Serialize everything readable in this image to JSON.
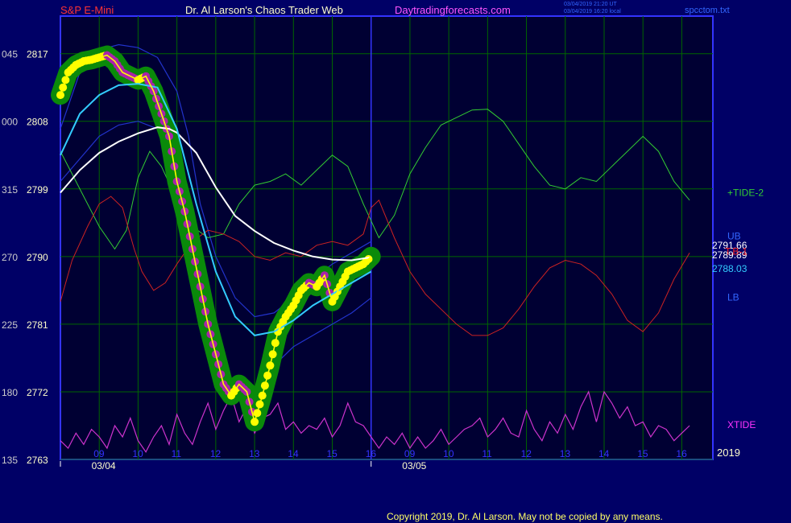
{
  "header": {
    "left": "S&P E-Mini",
    "center": "Dr. Al Larson's Chaos Trader Web",
    "site": "Daytradingforecasts.com",
    "stamp1": "03/04/2019 21:20 UT",
    "stamp2": "03/04/2019 16:20 local",
    "file": "spcctom.txt"
  },
  "footer": {
    "copyright": "Copyright 2019, Dr. Al Larson. May not be copied by any means."
  },
  "colors": {
    "background": "#000066",
    "plot_bg": "#000033",
    "grid": "#006600",
    "frame": "#3333ff",
    "price": "#ffff00",
    "aux_axis": "#cccccc",
    "price_axis": "#ffffcc",
    "tide2": "#33cc33",
    "red_tide": "#cc2222",
    "xtide": "#cc33cc",
    "white_ma": "#ffffff",
    "cyan_ma": "#33ccff",
    "blue_band": "#2233cc",
    "green_halo": "#0a8a0a",
    "yellow_dot": "#ffff00",
    "magenta_dot": "#aa22aa"
  },
  "chart_data": {
    "type": "line",
    "title": "S&P E-Mini",
    "ylim": [
      2763,
      2822
    ],
    "xlim": [
      8.0,
      24.8
    ],
    "y_ticks": [
      {
        "aux": "135",
        "price": "2763"
      },
      {
        "aux": "180",
        "price": "2772"
      },
      {
        "aux": "225",
        "price": "2781"
      },
      {
        "aux": "270",
        "price": "2790"
      },
      {
        "aux": "315",
        "price": "2799"
      },
      {
        "aux": "000",
        "price": "2808"
      },
      {
        "aux": "045",
        "price": "2817"
      }
    ],
    "x_ticks": [
      {
        "label": "09",
        "x": 9
      },
      {
        "label": "10",
        "x": 10
      },
      {
        "label": "11",
        "x": 11
      },
      {
        "label": "12",
        "x": 12
      },
      {
        "label": "13",
        "x": 13
      },
      {
        "label": "14",
        "x": 14
      },
      {
        "label": "15",
        "x": 15
      },
      {
        "label": "16",
        "x": 16
      },
      {
        "label": "09",
        "x": 17
      },
      {
        "label": "10",
        "x": 18
      },
      {
        "label": "11",
        "x": 19
      },
      {
        "label": "12",
        "x": 20
      },
      {
        "label": "13",
        "x": 21
      },
      {
        "label": "14",
        "x": 22
      },
      {
        "label": "15",
        "x": 23
      },
      {
        "label": "16",
        "x": 24
      }
    ],
    "date_labels": [
      {
        "label": "03/04",
        "x": 8.8
      },
      {
        "label": "03/05",
        "x": 16.8
      }
    ],
    "year_label": "2019",
    "day_divider_x": 16.0,
    "series": [
      {
        "name": "price",
        "x": [
          8.0,
          8.2,
          8.4,
          8.6,
          8.8,
          9.0,
          9.2,
          9.4,
          9.6,
          9.8,
          10.0,
          10.2,
          10.4,
          10.6,
          10.8,
          11.0,
          11.2,
          11.4,
          11.6,
          11.8,
          12.0,
          12.2,
          12.4,
          12.6,
          12.8,
          13.0,
          13.2,
          13.4,
          13.6,
          13.8,
          14.0,
          14.2,
          14.4,
          14.6,
          14.8,
          15.0,
          15.2,
          15.4,
          15.6,
          15.8,
          16.0
        ],
        "y": [
          2811.5,
          2814.5,
          2815.5,
          2816.0,
          2816.2,
          2816.5,
          2816.8,
          2816.0,
          2814.5,
          2814.0,
          2813.5,
          2814.0,
          2812.0,
          2809.0,
          2806.0,
          2800.0,
          2796.0,
          2791.0,
          2786.0,
          2781.0,
          2777.0,
          2773.0,
          2771.5,
          2773.0,
          2772.0,
          2768.0,
          2771.5,
          2775.5,
          2780.0,
          2782.0,
          2783.5,
          2785.5,
          2786.5,
          2786.0,
          2787.5,
          2784.0,
          2786.0,
          2788.0,
          2788.5,
          2789.0,
          2790.0
        ]
      },
      {
        "name": "white",
        "x": [
          8.0,
          8.5,
          9.0,
          9.5,
          10.0,
          10.5,
          10.8,
          11.0,
          11.5,
          12.0,
          12.5,
          13.0,
          13.5,
          14.0,
          14.5,
          15.0,
          15.5,
          16.0
        ],
        "y": [
          2798.5,
          2801.5,
          2803.8,
          2805.3,
          2806.4,
          2807.2,
          2807.0,
          2806.5,
          2803.8,
          2799.2,
          2795.4,
          2793.4,
          2791.8,
          2790.8,
          2790.0,
          2789.6,
          2789.5,
          2789.9
        ]
      },
      {
        "name": "cyan",
        "x": [
          8.0,
          8.5,
          9.0,
          9.5,
          10.0,
          10.5,
          11.0,
          11.5,
          12.0,
          12.5,
          13.0,
          13.5,
          14.0,
          14.5,
          15.0,
          15.5,
          16.0
        ],
        "y": [
          2803.5,
          2809.0,
          2811.5,
          2812.8,
          2813.0,
          2812.5,
          2807.0,
          2797.0,
          2788.0,
          2782.0,
          2779.5,
          2780.0,
          2781.5,
          2783.5,
          2785.0,
          2786.5,
          2788.0
        ]
      },
      {
        "name": "+TIDE-2",
        "x": [
          8.0,
          8.3,
          8.6,
          9.0,
          9.4,
          9.7,
          10.0,
          10.3,
          10.6,
          11.0,
          11.4,
          11.8,
          12.2,
          12.6,
          13.0,
          13.4,
          13.8,
          14.2,
          14.6,
          15.0,
          15.4,
          15.8,
          16.2,
          16.6,
          17.0,
          17.4,
          17.8,
          18.2,
          18.6,
          19.0,
          19.4,
          19.8,
          20.2,
          20.6,
          21.0,
          21.4,
          21.8,
          22.2,
          22.6,
          23.0,
          23.4,
          23.8,
          24.2
        ],
        "y": [
          2804.0,
          2801.0,
          2798.0,
          2794.0,
          2791.0,
          2793.5,
          2800.5,
          2804.0,
          2802.0,
          2797.5,
          2794.0,
          2792.5,
          2793.0,
          2797.0,
          2799.5,
          2800.0,
          2801.0,
          2799.5,
          2801.5,
          2803.5,
          2802.0,
          2797.0,
          2792.5,
          2795.5,
          2801.0,
          2804.5,
          2807.5,
          2808.5,
          2809.5,
          2809.6,
          2808.0,
          2805.0,
          2802.0,
          2799.5,
          2799.0,
          2800.5,
          2800.0,
          2802.0,
          2804.0,
          2806.0,
          2804.0,
          2800.0,
          2797.5
        ]
      },
      {
        "name": "red tide",
        "x": [
          8.0,
          8.3,
          8.7,
          9.0,
          9.3,
          9.6,
          9.9,
          10.1,
          10.4,
          10.7,
          11.0,
          11.4,
          11.8,
          12.2,
          12.6,
          13.0,
          13.4,
          13.8,
          14.2,
          14.6,
          15.0,
          15.4,
          15.8,
          16.0,
          16.2,
          16.6,
          17.0,
          17.4,
          17.8,
          18.2,
          18.6,
          19.0,
          19.4,
          19.8,
          20.2,
          20.6,
          21.0,
          21.4,
          21.8,
          22.2,
          22.6,
          23.0,
          23.4,
          23.8,
          24.2
        ],
        "y": [
          2784.0,
          2789.5,
          2794.0,
          2797.0,
          2798.0,
          2796.5,
          2791.0,
          2788.0,
          2785.5,
          2786.5,
          2789.0,
          2792.0,
          2793.5,
          2793.0,
          2792.0,
          2790.0,
          2789.5,
          2790.5,
          2790.0,
          2791.5,
          2792.0,
          2791.5,
          2793.0,
          2796.5,
          2797.5,
          2792.5,
          2788.0,
          2785.0,
          2783.0,
          2781.0,
          2779.5,
          2779.5,
          2780.5,
          2783.0,
          2786.0,
          2788.5,
          2789.5,
          2789.0,
          2787.5,
          2785.0,
          2781.5,
          2780.0,
          2782.5,
          2787.0,
          2790.5
        ]
      },
      {
        "name": "XTIDE",
        "x": [
          8.0,
          8.2,
          8.4,
          8.6,
          8.8,
          9.0,
          9.2,
          9.4,
          9.6,
          9.8,
          10.0,
          10.2,
          10.4,
          10.6,
          10.8,
          11.0,
          11.2,
          11.4,
          11.6,
          11.8,
          12.0,
          12.2,
          12.4,
          12.6,
          12.8,
          13.0,
          13.2,
          13.4,
          13.6,
          13.8,
          14.0,
          14.2,
          14.4,
          14.6,
          14.8,
          15.0,
          15.2,
          15.4,
          15.6,
          15.8,
          16.0,
          16.2,
          16.4,
          16.6,
          16.8,
          17.0,
          17.2,
          17.4,
          17.6,
          17.8,
          18.0,
          18.2,
          18.4,
          18.6,
          18.8,
          19.0,
          19.2,
          19.4,
          19.6,
          19.8,
          20.0,
          20.2,
          20.4,
          20.6,
          20.8,
          21.0,
          21.2,
          21.4,
          21.6,
          21.8,
          22.0,
          22.2,
          22.4,
          22.6,
          22.8,
          23.0,
          23.2,
          23.4,
          23.6,
          23.8,
          24.0,
          24.2
        ],
        "y": [
          2765.5,
          2764.5,
          2766.5,
          2765.0,
          2767.0,
          2766.0,
          2764.5,
          2767.5,
          2766.0,
          2768.5,
          2765.5,
          2764.0,
          2766.0,
          2767.5,
          2765.0,
          2769.0,
          2766.5,
          2765.0,
          2768.0,
          2770.5,
          2767.0,
          2769.5,
          2771.5,
          2768.0,
          2770.0,
          2766.5,
          2768.5,
          2769.0,
          2770.5,
          2767.0,
          2768.0,
          2766.5,
          2767.5,
          2767.0,
          2768.5,
          2766.0,
          2767.5,
          2770.5,
          2768.0,
          2767.5,
          2766.0,
          2764.5,
          2766.0,
          2765.0,
          2766.5,
          2764.5,
          2766.0,
          2764.5,
          2765.5,
          2767.0,
          2765.0,
          2766.0,
          2767.0,
          2767.5,
          2768.5,
          2766.0,
          2767.0,
          2768.5,
          2766.5,
          2766.0,
          2769.5,
          2767.0,
          2765.5,
          2768.0,
          2766.5,
          2769.0,
          2767.0,
          2770.0,
          2772.0,
          2768.0,
          2772.0,
          2770.5,
          2768.5,
          2770.0,
          2767.5,
          2768.0,
          2766.0,
          2767.5,
          2767.0,
          2765.5,
          2766.5,
          2767.5
        ]
      },
      {
        "name": "upper band",
        "x": [
          8.0,
          8.5,
          9.0,
          9.5,
          10.0,
          10.5,
          11.0,
          11.3,
          11.6,
          12.0,
          12.5,
          13.0,
          13.5,
          14.0,
          14.5,
          15.0,
          15.5,
          16.0
        ],
        "y": [
          2807.0,
          2814.5,
          2817.5,
          2818.2,
          2817.8,
          2816.5,
          2812.0,
          2806.0,
          2797.0,
          2790.0,
          2784.5,
          2782.0,
          2782.5,
          2784.5,
          2787.0,
          2789.0,
          2790.5,
          2792.0
        ]
      },
      {
        "name": "lower band",
        "x": [
          8.0,
          8.5,
          9.0,
          9.5,
          10.0,
          10.5,
          11.0,
          11.3,
          11.6,
          12.0,
          12.5,
          13.0,
          13.5,
          14.0,
          14.5,
          15.0,
          15.5,
          16.0
        ],
        "y": [
          2800.0,
          2803.0,
          2806.0,
          2807.5,
          2808.0,
          2807.0,
          2800.5,
          2793.0,
          2784.0,
          2776.5,
          2772.5,
          2772.5,
          2775.5,
          2778.0,
          2779.5,
          2781.0,
          2782.5,
          2784.5
        ]
      }
    ],
    "right_labels": [
      {
        "text": "+TIDE-2",
        "y": 2798.5
      },
      {
        "text": "UB",
        "y": 2792.7
      },
      {
        "text": "2791.66",
        "y": 2791.5
      },
      {
        "text": "2789.89",
        "y": 2790.2
      },
      {
        "text": "T.B-1",
        "y": 2790.7
      },
      {
        "text": "2788.03",
        "y": 2788.4
      },
      {
        "text": "LB",
        "y": 2784.6
      },
      {
        "text": "XTIDE",
        "y": 2767.6
      }
    ]
  }
}
